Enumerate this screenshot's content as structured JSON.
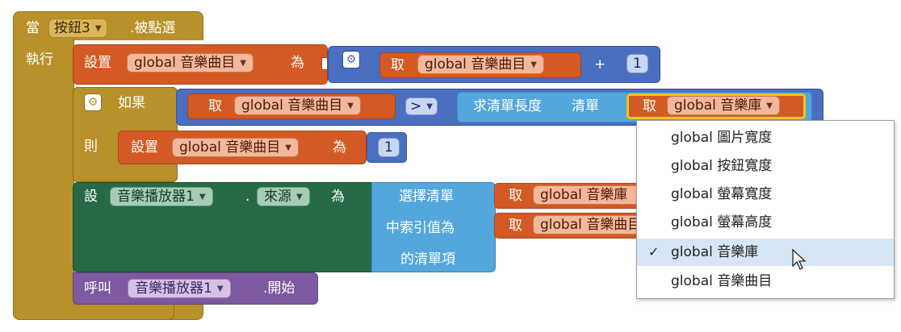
{
  "event_block": {
    "prefix": "當",
    "component": "按鈕3",
    "event": ".被點選",
    "do_label": "執行"
  },
  "set_index_block": {
    "set_label": "設置",
    "variable": "global 音樂曲目",
    "to_label": "為",
    "get_label": "取",
    "get_variable": "global 音樂曲目",
    "operator": "+",
    "number": "1"
  },
  "if_block": {
    "if_label": "如果",
    "then_label": "則",
    "get_label": "取",
    "get_variable": "global 音樂曲目",
    "compare_op": ">",
    "length_label": "求清單長度",
    "list_label": "清單",
    "list_get_label": "取",
    "list_variable": "global 音樂庫",
    "reset_set_label": "設置",
    "reset_variable": "global 音樂曲目",
    "reset_to_label": "為",
    "reset_number": "1"
  },
  "set_source_block": {
    "set_label": "設",
    "component": "音樂播放器1",
    "dot": ".",
    "property": "來源",
    "to_label": "為",
    "select_line1": "選擇清單",
    "select_line2": "中索引值為",
    "select_line3": "的清單項",
    "list_get_label": "取",
    "list_variable": "global 音樂庫",
    "index_get_label": "取",
    "index_variable": "global 音樂曲目"
  },
  "call_block": {
    "call_label": "呼叫",
    "component": "音樂播放器1",
    "method": ".開始"
  },
  "dropdown": {
    "items": [
      {
        "label": "global 圖片寬度",
        "checked": false
      },
      {
        "label": "global 按鈕寬度",
        "checked": false
      },
      {
        "label": "global 螢幕寬度",
        "checked": false
      },
      {
        "label": "global 螢幕高度",
        "checked": false
      },
      {
        "label": "global 音樂庫",
        "checked": true
      },
      {
        "label": "global 音樂曲目",
        "checked": false
      }
    ],
    "check_mark": "✓"
  },
  "colors": {
    "event": "#b8912a",
    "variables": "#d35a24",
    "math": "#4a6fc1",
    "component_set": "#276a48",
    "lists": "#53a7dd",
    "component_call": "#7d5aa0"
  }
}
